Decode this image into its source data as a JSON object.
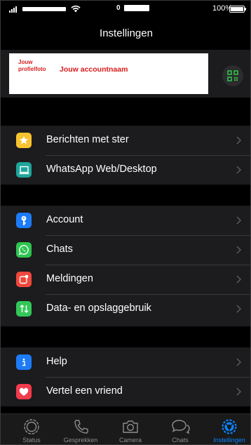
{
  "status_bar": {
    "battery_percent": "100%",
    "time_prefix": "0",
    "icons": [
      "signal-icon",
      "wifi-icon",
      "battery-icon"
    ]
  },
  "nav": {
    "title": "Instellingen"
  },
  "profile": {
    "photo_label": "Jouw profielfoto",
    "account_name": "Jouw accountnaam",
    "qr_icon": "qr-code-icon",
    "colors": {
      "placeholder_text": "#d81b1b",
      "card": "#ffffff"
    }
  },
  "groups": [
    {
      "items": [
        {
          "label": "Berichten met ster",
          "icon": "star-icon",
          "color": "#f7c431"
        },
        {
          "label": "WhatsApp Web/Desktop",
          "icon": "laptop-icon",
          "color": "#1fa59b"
        }
      ]
    },
    {
      "items": [
        {
          "label": "Account",
          "icon": "key-icon",
          "color": "#1d7bf7"
        },
        {
          "label": "Chats",
          "icon": "whatsapp-icon",
          "color": "#2fc551"
        },
        {
          "label": "Meldingen",
          "icon": "notification-icon",
          "color": "#f1473d"
        },
        {
          "label": "Data- en opslaggebruik",
          "icon": "data-arrows-icon",
          "color": "#33c759"
        }
      ]
    },
    {
      "items": [
        {
          "label": "Help",
          "icon": "info-icon",
          "color": "#1d7bf7"
        },
        {
          "label": "Vertel een vriend",
          "icon": "heart-icon",
          "color": "#f23b4c"
        }
      ]
    }
  ],
  "tabbar": {
    "tabs": [
      {
        "label": "Status",
        "icon": "status-icon",
        "active": false
      },
      {
        "label": "Gesprekken",
        "icon": "phone-icon",
        "active": false
      },
      {
        "label": "Camera",
        "icon": "camera-icon",
        "active": false
      },
      {
        "label": "Chats",
        "icon": "chat-bubbles-icon",
        "active": false
      },
      {
        "label": "Instellingen",
        "icon": "settings-gear-icon",
        "active": true
      }
    ],
    "active_color": "#0a84ff",
    "inactive_color": "#8e8e93"
  },
  "theme": {
    "background": "#000000",
    "cell": "#1c1c1e",
    "separator": "#38383a"
  }
}
